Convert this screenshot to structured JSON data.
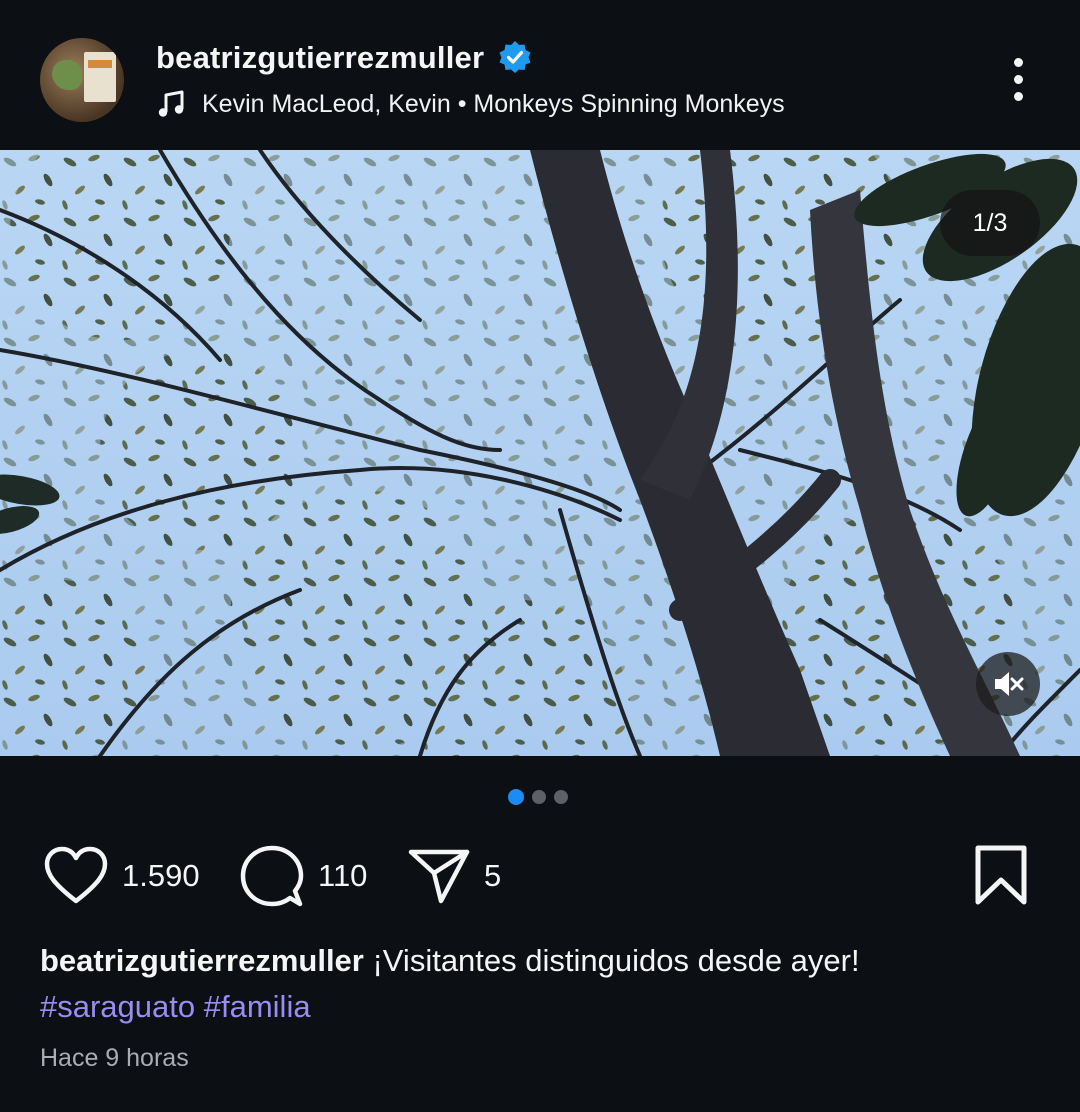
{
  "post": {
    "username": "beatrizgutierrezmuller",
    "music": "Kevin MacLeod, Kevin • Monkeys Spinning Monkeys",
    "media_counter": "1/3",
    "carousel": {
      "total": 3,
      "active_index": 0
    },
    "likes": "1.590",
    "comments": "110",
    "shares": "5",
    "caption_username": "beatrizgutierrezmuller",
    "caption_text": " ¡Visitantes distinguidos desde ayer!",
    "hashtags": [
      "#saraguato",
      "#familia"
    ],
    "timestamp": "Hace 9 horas"
  },
  "colors": {
    "background": "#0c0f14",
    "verified": "#1d9bf0",
    "hashtag": "#9b8cf2",
    "active_dot": "#1a8cf6",
    "muted_text": "#a9acb2"
  },
  "icons": [
    "verified-badge-icon",
    "music-note-icon",
    "more-options-icon",
    "speaker-muted-icon",
    "heart-icon",
    "comment-icon",
    "share-icon",
    "bookmark-icon"
  ]
}
